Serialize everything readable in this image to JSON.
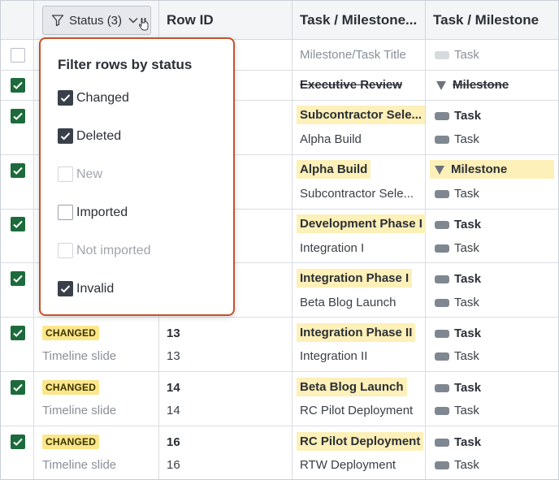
{
  "header": {
    "status_label": "Status (3)",
    "row_id": "Row ID",
    "task_col1": "Task / Milestone...",
    "task_col2": "Task / Milestone"
  },
  "filter_popup": {
    "title": "Filter rows by status",
    "options": [
      {
        "label": "Changed",
        "checked": true,
        "disabled": false
      },
      {
        "label": "Deleted",
        "checked": true,
        "disabled": false
      },
      {
        "label": "New",
        "checked": false,
        "disabled": true
      },
      {
        "label": "Imported",
        "checked": false,
        "disabled": false
      },
      {
        "label": "Not imported",
        "checked": false,
        "disabled": true
      },
      {
        "label": "Invalid",
        "checked": true,
        "disabled": false
      }
    ]
  },
  "rows": {
    "r0": {
      "title": "Milestone/Task Title",
      "type": "Task"
    },
    "r1": {
      "title": "Executive Review",
      "type": "Milestone"
    },
    "r2": {
      "title_a": "Subcontractor Sele...",
      "title_b": "Alpha Build",
      "type_a": "Task",
      "type_b": "Task"
    },
    "r3": {
      "title_a": "Alpha Build",
      "title_b": "Subcontractor Sele...",
      "type_a": "Milestone",
      "type_b": "Task"
    },
    "r4": {
      "title_a": "Development Phase I",
      "title_b": "Integration I",
      "type_a": "Task",
      "type_b": "Task"
    },
    "r5": {
      "title_a": "Integration Phase I",
      "title_b": "Beta Blog Launch",
      "type_a": "Task",
      "type_b": "Task"
    },
    "r6": {
      "badge": "CHANGED",
      "slide": "Timeline slide",
      "id_a": "13",
      "id_b": "13",
      "title_a": "Integration Phase II",
      "title_b": "Integration II",
      "type_a": "Task",
      "type_b": "Task"
    },
    "r7": {
      "badge": "CHANGED",
      "slide": "Timeline slide",
      "id_a": "14",
      "id_b": "14",
      "title_a": "Beta Blog Launch",
      "title_b": "RC Pilot Deployment",
      "type_a": "Task",
      "type_b": "Task"
    },
    "r8": {
      "badge": "CHANGED",
      "slide": "Timeline slide",
      "id_a": "16",
      "id_b": "16",
      "title_a": "RC Pilot Deployment",
      "title_b": "RTW Deployment",
      "type_a": "Task",
      "type_b": "Task"
    }
  },
  "colors": {
    "accent_border": "#c4522a",
    "checkbox_green": "#1d6b3c",
    "highlight": "#fdf0b8",
    "badge": "#fbe68a"
  }
}
